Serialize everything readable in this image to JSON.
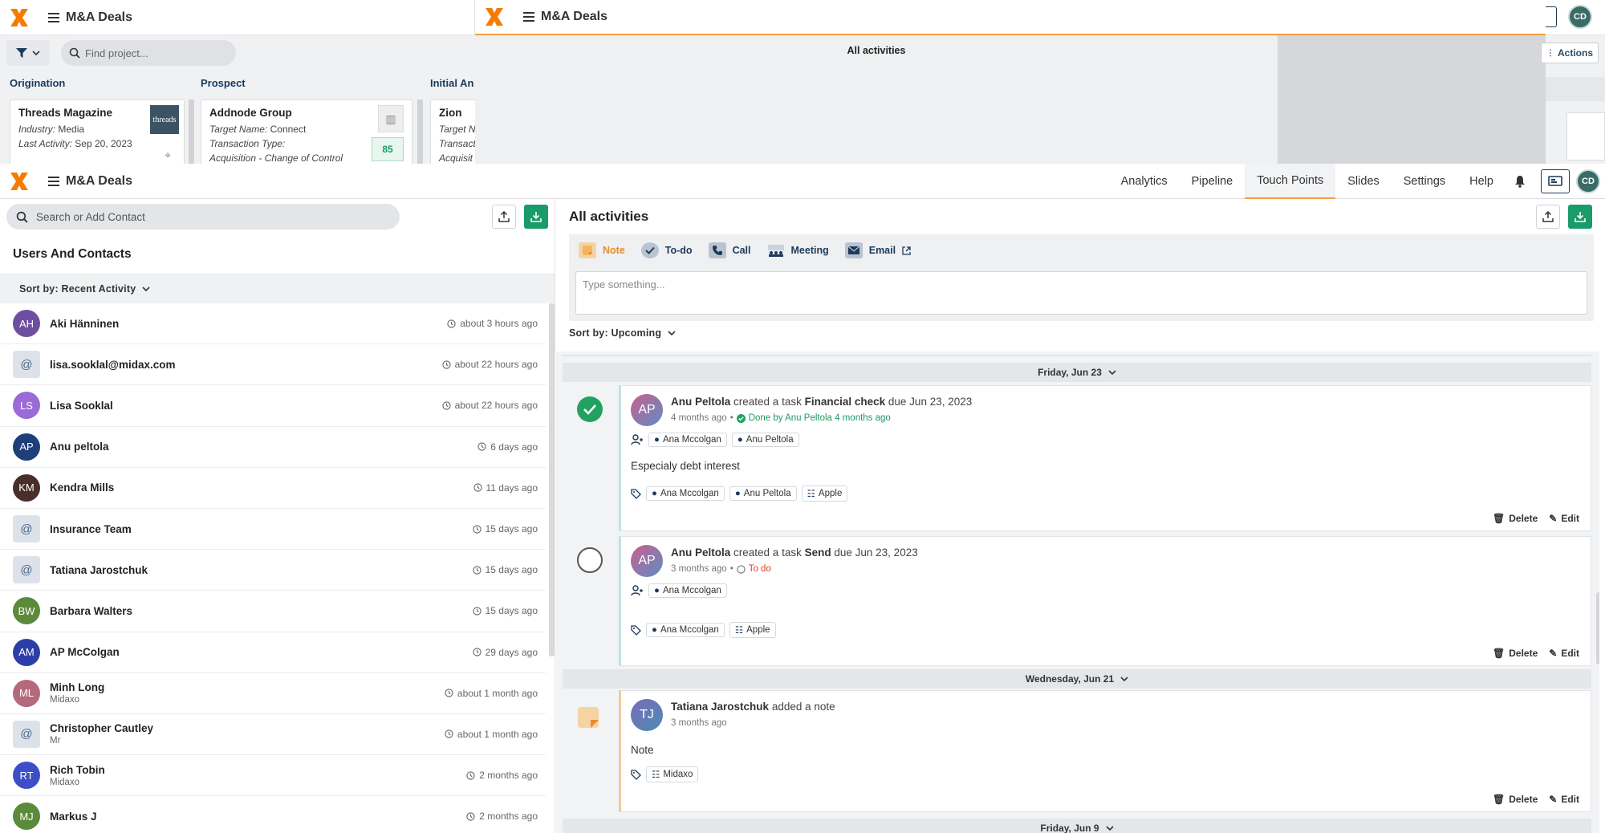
{
  "app": {
    "title": "M&A Deals",
    "user_initials": "CD"
  },
  "bg": {
    "find_placeholder": "Find project...",
    "stages": [
      "Origination",
      "Prospect",
      "Initial An"
    ],
    "cards": [
      {
        "title": "Threads Magazine",
        "line1_label": "Industry:",
        "line1_value": "Media",
        "line2_label": "Last Activity:",
        "line2_value": "Sep 20, 2023",
        "thumb": "threads"
      },
      {
        "title": "Addnode Group",
        "line1_label": "Target Name:",
        "line1_value": "Connect",
        "line2_label": "Transaction Type:",
        "line2_value": "",
        "line3": "Acquisition - Change of Control",
        "score": "85"
      },
      {
        "title": "Zion",
        "line1_label": "Target N",
        "line2_label": "Transact",
        "line3": "Acquisit"
      }
    ],
    "mid_title": "All activities",
    "actions_label": "Actions"
  },
  "nav": {
    "items": [
      "Analytics",
      "Pipeline",
      "Touch Points",
      "Slides",
      "Settings",
      "Help"
    ],
    "active": "Touch Points"
  },
  "contacts": {
    "search_placeholder": "Search or Add Contact",
    "title": "Users And Contacts",
    "sort_label": "Sort by: Recent Activity",
    "rows": [
      {
        "initials": "AH",
        "name": "Aki Hänninen",
        "sub": "",
        "time": "about 3 hours ago",
        "color": "#6f4ea0"
      },
      {
        "initials": "@",
        "name": "lisa.sooklal@midax.com",
        "sub": "",
        "time": "about 22 hours ago",
        "color": "at"
      },
      {
        "initials": "LS",
        "name": "Lisa Sooklal",
        "sub": "",
        "time": "about 22 hours ago",
        "color": "#9b6ad6"
      },
      {
        "initials": "AP",
        "name": "Anu peltola",
        "sub": "",
        "time": "6 days ago",
        "color": "#1e3f7a"
      },
      {
        "initials": "KM",
        "name": "Kendra Mills",
        "sub": "",
        "time": "11 days ago",
        "color": "#4a2e2a"
      },
      {
        "initials": "@",
        "name": "Insurance Team",
        "sub": "",
        "time": "15 days ago",
        "color": "at"
      },
      {
        "initials": "@",
        "name": "Tatiana Jarostchuk",
        "sub": "",
        "time": "15 days ago",
        "color": "at"
      },
      {
        "initials": "BW",
        "name": "Barbara Walters",
        "sub": "",
        "time": "15 days ago",
        "color": "#5c8a3a"
      },
      {
        "initials": "AM",
        "name": "AP McColgan",
        "sub": "",
        "time": "29 days ago",
        "color": "#2c3fa8"
      },
      {
        "initials": "ML",
        "name": "Minh Long",
        "sub": "Midaxo",
        "time": "about 1 month ago",
        "color": "#b46a7c"
      },
      {
        "initials": "@",
        "name": "Christopher Cautley",
        "sub": "Mr",
        "time": "about 1 month ago",
        "color": "at"
      },
      {
        "initials": "RT",
        "name": "Rich Tobin",
        "sub": "Midaxo",
        "time": "2 months ago",
        "color": "#3d4fc6"
      },
      {
        "initials": "MJ",
        "name": "Markus J",
        "sub": "",
        "time": "2 months ago",
        "color": "#5a8a3a"
      }
    ]
  },
  "activities": {
    "title": "All activities",
    "types": [
      "Note",
      "To-do",
      "Call",
      "Meeting",
      "Email"
    ],
    "placeholder": "Type something...",
    "sort_label": "Sort by: Upcoming",
    "dates": [
      "Friday, Jun 23",
      "Wednesday, Jun 21",
      "Friday, Jun 9"
    ],
    "items": [
      {
        "initials": "AP",
        "actor": "Anu Peltola",
        "verb": "created a task",
        "task": "Financial check",
        "due": "due Jun 23, 2023",
        "ago": "4 months ago",
        "status": "Done by Anu Peltola 4 months ago",
        "assignees": [
          "Ana Mccolgan",
          "Anu Peltola"
        ],
        "body": "Especialy debt interest",
        "tags": [
          "Ana Mccolgan",
          "Anu Peltola",
          "Apple"
        ]
      },
      {
        "initials": "AP",
        "actor": "Anu Peltola",
        "verb": "created a task",
        "task": "Send",
        "due": "due Jun 23, 2023",
        "ago": "3 months ago",
        "status": "To do",
        "assignees": [
          "Ana Mccolgan"
        ],
        "body": "",
        "tags": [
          "Ana Mccolgan",
          "Apple"
        ]
      },
      {
        "initials": "TJ",
        "actor": "Tatiana Jarostchuk",
        "verb": "added a note",
        "ago": "3 months ago",
        "body": "Note",
        "tags": [
          "Midaxo"
        ]
      }
    ],
    "delete_label": "Delete",
    "edit_label": "Edit"
  },
  "colors": {
    "accent": "#f0a040",
    "brand": "#f57c00",
    "navy": "#1d3a5a",
    "green": "#1a9b6a"
  }
}
